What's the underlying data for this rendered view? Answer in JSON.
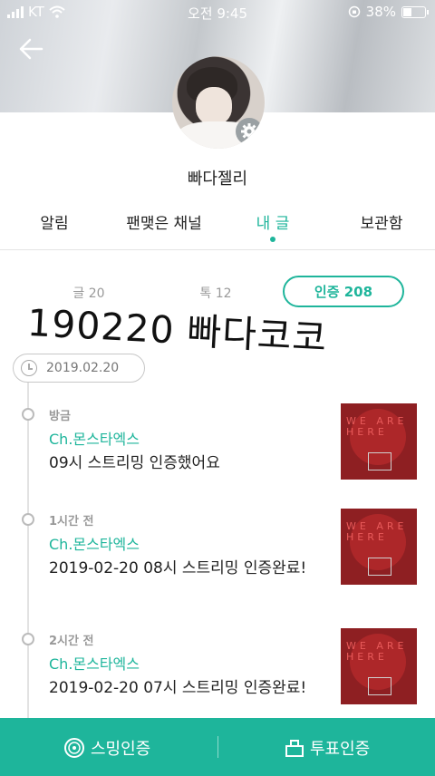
{
  "status_bar": {
    "carrier": "KT",
    "time": "오전 9:45",
    "battery_percent": "38%"
  },
  "profile": {
    "nickname": "빠다젤리"
  },
  "tabs": [
    {
      "label": "알림",
      "active": false
    },
    {
      "label": "팬맺은 채널",
      "active": false
    },
    {
      "label": "내 글",
      "active": true
    },
    {
      "label": "보관함",
      "active": false
    }
  ],
  "filters": {
    "posts": "글 20",
    "talks": "톡 12",
    "verifications": "인증 208"
  },
  "overlay_text": "190220 빠다코코",
  "timeline": {
    "date": "2019.02.20",
    "entries": [
      {
        "when": "방금",
        "channel": "Ch.몬스타엑스",
        "text": "09시 스트리밍 인증했어요"
      },
      {
        "when": "1시간 전",
        "channel": "Ch.몬스타엑스",
        "text": "2019-02-20 08시 스트리밍 인증완료!"
      },
      {
        "when": "2시간 전",
        "channel": "Ch.몬스타엑스",
        "text": "2019-02-20 07시 스트리밍 인증완료!"
      }
    ],
    "thumb_lettering": "WE ARE HERE"
  },
  "bottom_bar": {
    "streaming_label": "스밍인증",
    "vote_label": "투표인증"
  },
  "colors": {
    "accent": "#1eb59b",
    "thumb_bg": "#8e1f22"
  }
}
